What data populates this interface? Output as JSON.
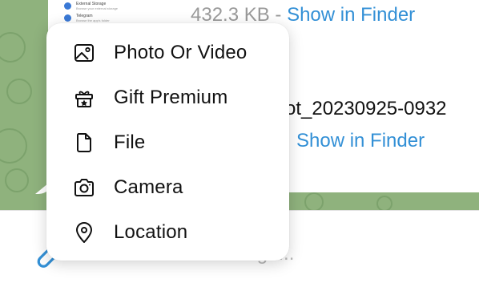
{
  "chat": {
    "thumbnail_items": [
      {
        "title": "External Storage",
        "subtitle": "Browse your external storage"
      },
      {
        "title": "Telegram",
        "subtitle": "Browse the app's folder"
      }
    ],
    "file1": {
      "size": "432.3 KB",
      "separator": " - ",
      "action": "Show in Finder"
    },
    "file2": {
      "name_fragment": "ot_20230925-0932",
      "action": "Show in Finder"
    },
    "input_placeholder": "Message..."
  },
  "attach_menu": {
    "items": [
      {
        "label": "Photo Or Video",
        "icon": "photo-icon"
      },
      {
        "label": "Gift Premium",
        "icon": "gift-icon"
      },
      {
        "label": "File",
        "icon": "file-icon"
      },
      {
        "label": "Camera",
        "icon": "camera-icon"
      },
      {
        "label": "Location",
        "icon": "location-pin-icon"
      }
    ]
  },
  "colors": {
    "wallpaper": "#8fb27d",
    "link": "#3390d6",
    "attach_icon": "#3390d6"
  }
}
